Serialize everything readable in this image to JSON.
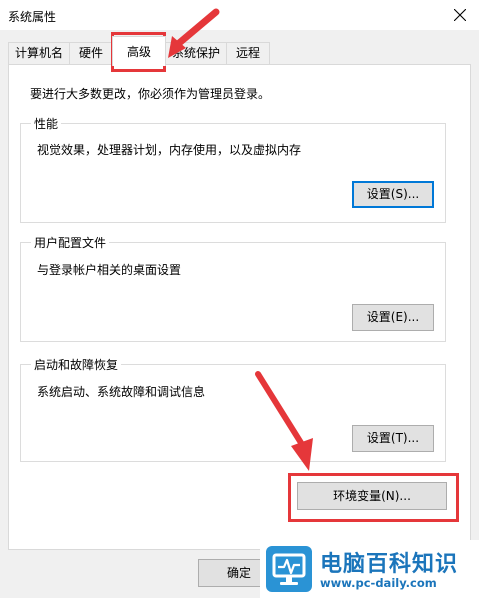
{
  "window": {
    "title": "系统属性"
  },
  "tabs": [
    {
      "label": "计算机名"
    },
    {
      "label": "硬件"
    },
    {
      "label": "高级"
    },
    {
      "label": "系统保护"
    },
    {
      "label": "远程"
    }
  ],
  "active_tab": "高级",
  "main": {
    "intro": "要进行大多数更改，你必须作为管理员登录。",
    "performance": {
      "title": "性能",
      "description": "视觉效果，处理器计划，内存使用，以及虚拟内存",
      "button": "设置(S)..."
    },
    "user_profiles": {
      "title": "用户配置文件",
      "description": "与登录帐户相关的桌面设置",
      "button": "设置(E)..."
    },
    "startup_recovery": {
      "title": "启动和故障恢复",
      "description": "系统启动、系统故障和调试信息",
      "button": "设置(T)..."
    },
    "env_button": "环境变量(N)..."
  },
  "footer": {
    "ok_button": "确定"
  },
  "watermark": {
    "text": "电脑百科知识",
    "url": "www.pc-daily.com"
  },
  "colors": {
    "accent": "#0078d7",
    "highlight": "#e5373a",
    "watermark": "#1b75bb"
  },
  "icons": {
    "close": "close-icon",
    "monitor": "monitor-icon"
  }
}
